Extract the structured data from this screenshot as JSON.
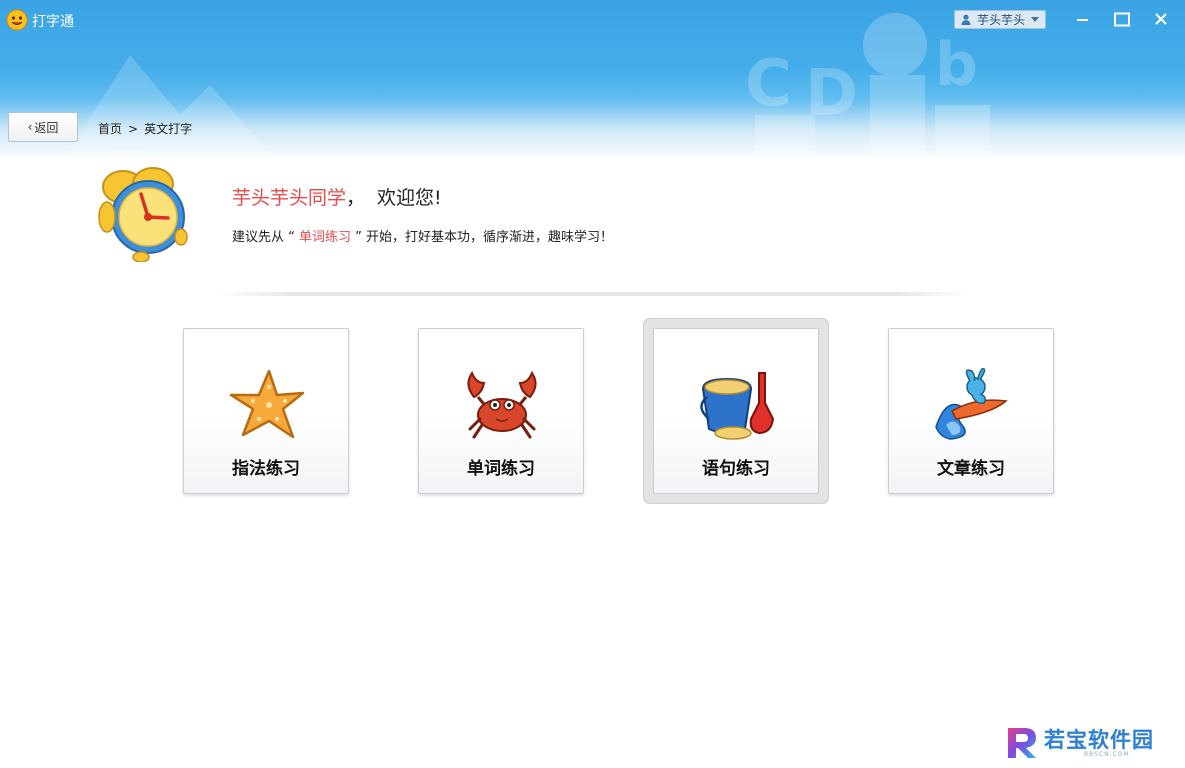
{
  "window": {
    "title": "打字通",
    "user_name": "芋头芋头"
  },
  "nav": {
    "back_label": "返回",
    "breadcrumb": [
      "首页",
      "英文打字"
    ],
    "breadcrumb_sep": ">"
  },
  "welcome": {
    "student": "芋头芋头同学",
    "comma": "，",
    "greeting": "欢迎您!",
    "suggest_prefix": "建议先从 “ ",
    "suggest_highlight": "单词练习",
    "suggest_suffix": " ” 开始，打好基本功，循序渐进，趣味学习！"
  },
  "cards": [
    {
      "label": "指法练习",
      "icon": "starfish-icon",
      "selected": false
    },
    {
      "label": "单词练习",
      "icon": "crab-icon",
      "selected": false
    },
    {
      "label": "语句练习",
      "icon": "sand-bucket-icon",
      "selected": true
    },
    {
      "label": "文章练习",
      "icon": "surfing-rabbit-icon",
      "selected": false
    }
  ],
  "watermark": {
    "text": "若宝软件园",
    "sub": "RBSCN.COM"
  },
  "colors": {
    "banner_blue": "#3aa3e4",
    "highlight_red": "#e84b4b",
    "watermark_blue": "#2d7fd6"
  }
}
